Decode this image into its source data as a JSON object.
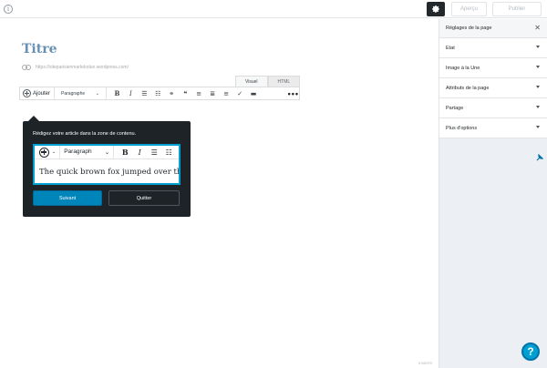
{
  "topbar": {
    "info_icon": "info-icon",
    "settings_icon": "gear-icon",
    "preview_label": "Aperçu",
    "publish_label": "Publier"
  },
  "editor": {
    "title": "Titre",
    "permalink": "https://siteparisienmarkdodun.wordpress.com/",
    "tabs": [
      {
        "label": "Visuel",
        "active": true
      },
      {
        "label": "HTML",
        "active": false
      }
    ],
    "toolbar": {
      "add_label": "Ajouter",
      "format_value": "Paragraphe",
      "icons": [
        "bold-icon",
        "italic-icon",
        "bullet-list-icon",
        "numbered-list-icon",
        "link-icon",
        "quote-icon",
        "align-left-icon",
        "align-center-icon",
        "align-right-icon",
        "spellcheck-icon",
        "horizontal-rule-icon",
        "more-icon"
      ]
    },
    "word_count": "0 MOTS"
  },
  "tour_popup": {
    "message": "Rédigez votre article dans la zone de contenu.",
    "demo": {
      "format_value": "Paragraph",
      "sample_text": "The quick brown fox jumped over the lazy"
    },
    "next_label": "Suivant",
    "quit_label": "Quitter"
  },
  "sidebar": {
    "title": "Réglages de la page",
    "panels": [
      {
        "label": "Etat"
      },
      {
        "label": "Image à la Une"
      },
      {
        "label": "Attributs de la page"
      },
      {
        "label": "Partage"
      },
      {
        "label": "Plus d'options"
      }
    ],
    "help_label": "?"
  },
  "colors": {
    "accent": "#0085ba",
    "title": "#6790b5",
    "popup_bg": "#1e2327",
    "sidebar_bg": "#ecf0f4"
  }
}
